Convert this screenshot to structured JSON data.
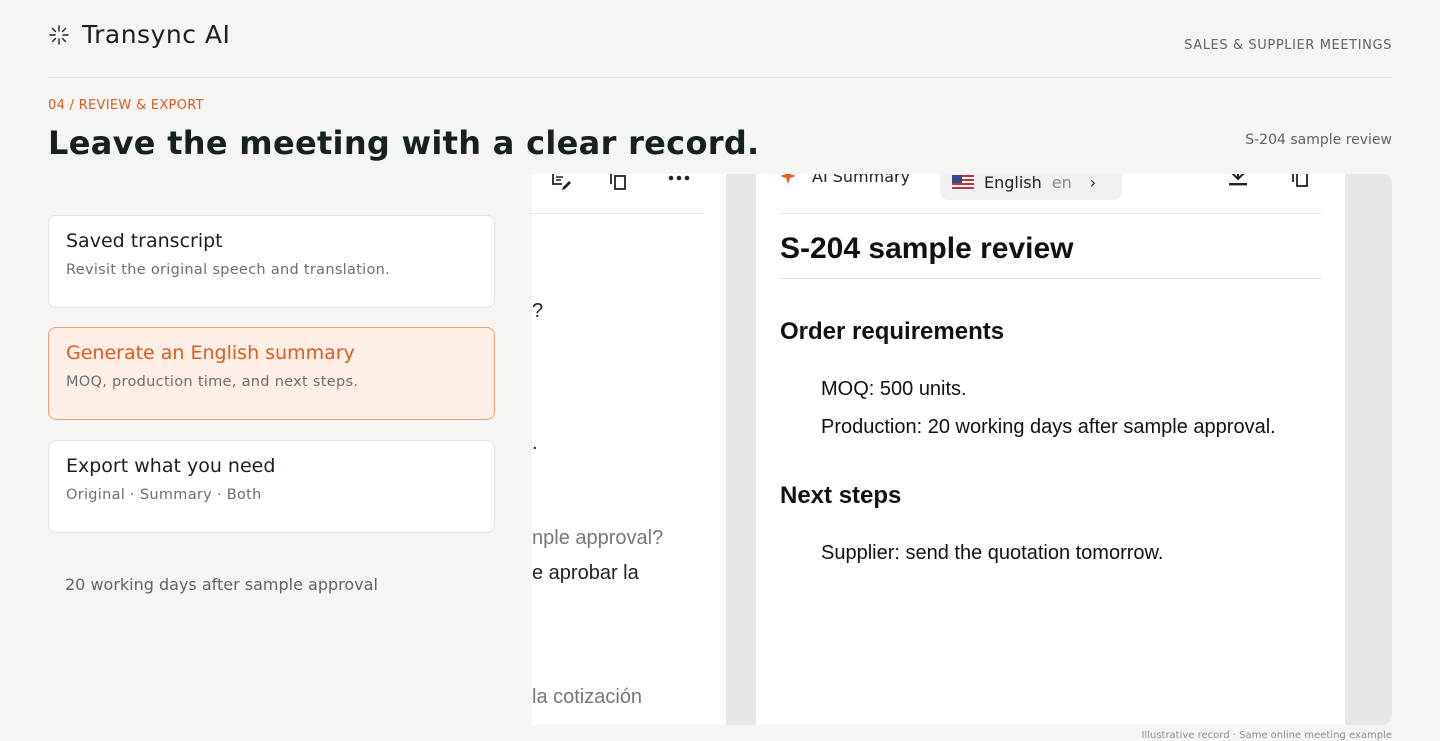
{
  "brand": {
    "name": "Transync AI",
    "icon": "sparkle-grid-icon"
  },
  "header": {
    "tag": "SALES & SUPPLIER MEETINGS"
  },
  "section": {
    "step": "04 / REVIEW & EXPORT",
    "headline": "Leave the meeting with a clear record.",
    "sample_ref": "S-204 sample review"
  },
  "cards": [
    {
      "title": "Saved transcript",
      "desc": "Revisit the original speech and translation.",
      "active": false
    },
    {
      "title": "Generate an English summary",
      "desc": "MOQ, production time, and next steps.",
      "active": true
    },
    {
      "title": "Export what you need",
      "desc": "Original · Summary · Both",
      "active": false
    }
  ],
  "left_footnote": "20 working days after sample approval",
  "transcript_pane": {
    "toolbar_icons": [
      "edit-icon",
      "copy-icon",
      "more-icon"
    ],
    "lines": [
      {
        "text": "?",
        "muted": false
      },
      {
        "text": ".",
        "muted": false
      },
      {
        "text": "nple approval?",
        "muted": true
      },
      {
        "text": "e aprobar la",
        "muted": false
      },
      {
        "text": "la cotización",
        "muted": true
      }
    ]
  },
  "summary_pane": {
    "tab_label": "AI Summary",
    "tab_icon": "ai-sparkle-icon",
    "language": {
      "name": "English",
      "code": "en",
      "flag": "us-flag-icon"
    },
    "actions": [
      "download-icon",
      "copy-icon"
    ],
    "doc_title": "S-204 sample review",
    "sections": [
      {
        "heading": "Order requirements",
        "items": [
          "MOQ: 500 units.",
          "Production: 20 working days after sample approval."
        ]
      },
      {
        "heading": "Next steps",
        "items": [
          "Supplier: send the quotation tomorrow."
        ]
      }
    ]
  },
  "caption": "Illustrative record · Same online meeting example",
  "colors": {
    "accent": "#e05a1e",
    "accent_bg": "#fdeee6",
    "page_bg": "#f5f5f3"
  }
}
